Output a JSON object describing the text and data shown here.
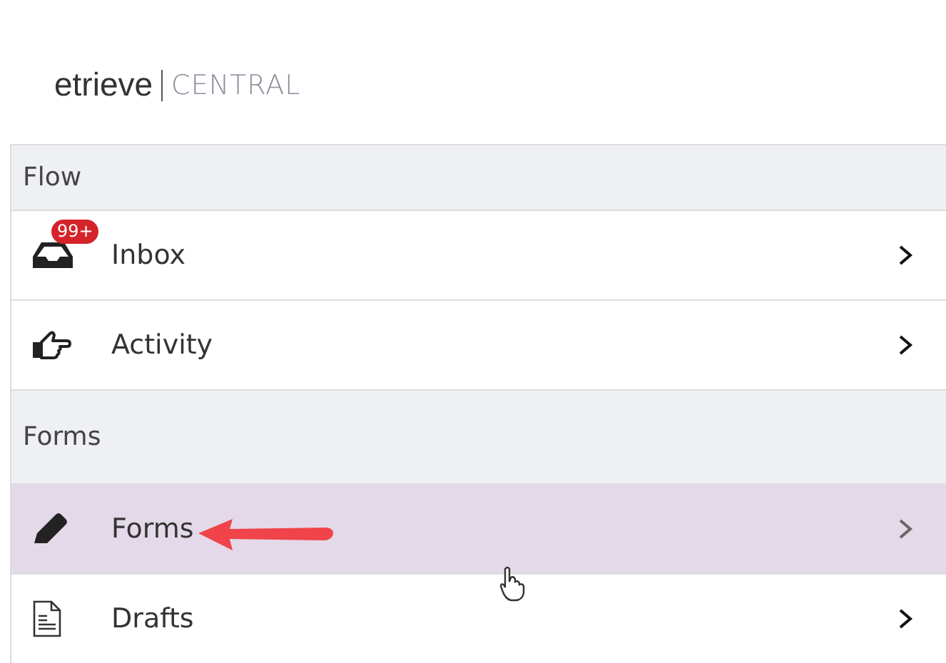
{
  "logo": {
    "brand": "etrieve",
    "product": "CENTRAL"
  },
  "sections": [
    {
      "title": "Flow",
      "items": [
        {
          "label": "Inbox",
          "kind": "inbox",
          "badge": "99+",
          "selected": false
        },
        {
          "label": "Activity",
          "kind": "hand",
          "selected": false
        }
      ]
    },
    {
      "title": "Forms",
      "items": [
        {
          "label": "Forms",
          "kind": "pencil",
          "selected": true
        },
        {
          "label": "Drafts",
          "kind": "document",
          "selected": false
        }
      ]
    }
  ]
}
